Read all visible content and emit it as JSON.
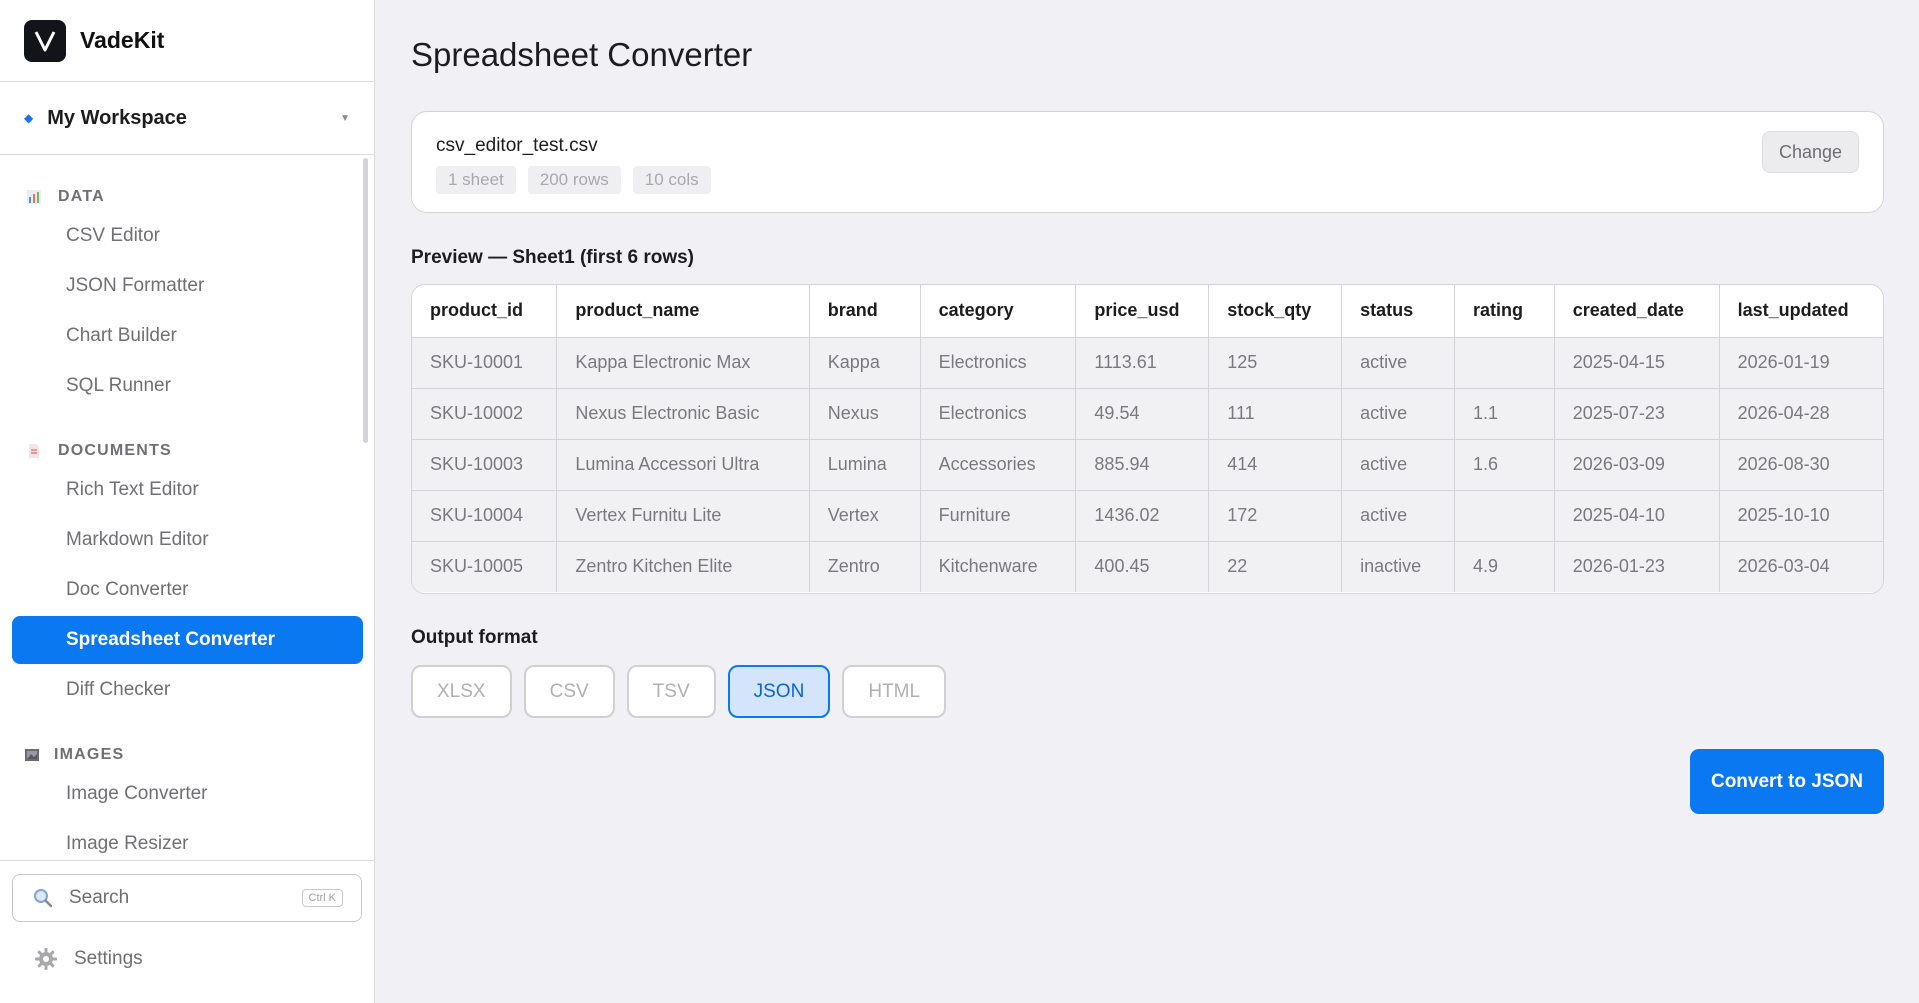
{
  "app": {
    "name": "VadeKit"
  },
  "workspace": {
    "name": "My Workspace"
  },
  "sidebar": {
    "sections": [
      {
        "title": "DATA",
        "icon": "bar-chart-icon",
        "items": [
          "CSV Editor",
          "JSON Formatter",
          "Chart Builder",
          "SQL Runner"
        ]
      },
      {
        "title": "DOCUMENTS",
        "icon": "document-icon",
        "items": [
          "Rich Text Editor",
          "Markdown Editor",
          "Doc Converter",
          "Spreadsheet Converter",
          "Diff Checker"
        ]
      },
      {
        "title": "IMAGES",
        "icon": "image-icon",
        "items": [
          "Image Converter",
          "Image Resizer"
        ]
      }
    ],
    "active_item": "Spreadsheet Converter",
    "search": {
      "label": "Search",
      "shortcut": "Ctrl K"
    },
    "settings_label": "Settings"
  },
  "main": {
    "title": "Spreadsheet Converter",
    "file": {
      "name": "csv_editor_test.csv",
      "chips": [
        "1 sheet",
        "200 rows",
        "10 cols"
      ],
      "change_label": "Change"
    },
    "preview": {
      "title": "Preview — Sheet1 (first 6 rows)",
      "columns": [
        "product_id",
        "product_name",
        "brand",
        "category",
        "price_usd",
        "stock_qty",
        "status",
        "rating",
        "created_date",
        "last_updated"
      ],
      "rows": [
        [
          "SKU-10001",
          "Kappa Electronic Max",
          "Kappa",
          "Electronics",
          "1113.61",
          "125",
          "active",
          "",
          "2025-04-15",
          "2026-01-19"
        ],
        [
          "SKU-10002",
          "Nexus Electronic Basic",
          "Nexus",
          "Electronics",
          "49.54",
          "111",
          "active",
          "1.1",
          "2025-07-23",
          "2026-04-28"
        ],
        [
          "SKU-10003",
          "Lumina Accessori Ultra",
          "Lumina",
          "Accessories",
          "885.94",
          "414",
          "active",
          "1.6",
          "2026-03-09",
          "2026-08-30"
        ],
        [
          "SKU-10004",
          "Vertex Furnitu Lite",
          "Vertex",
          "Furniture",
          "1436.02",
          "172",
          "active",
          "",
          "2025-04-10",
          "2025-10-10"
        ],
        [
          "SKU-10005",
          "Zentro Kitchen Elite",
          "Zentro",
          "Kitchenware",
          "400.45",
          "22",
          "inactive",
          "4.9",
          "2026-01-23",
          "2026-03-04"
        ]
      ]
    },
    "output": {
      "title": "Output format",
      "formats": [
        "XLSX",
        "CSV",
        "TSV",
        "JSON",
        "HTML"
      ],
      "selected": "JSON"
    },
    "convert_label": "Convert to JSON"
  },
  "colors": {
    "accent": "#0a78f0",
    "accent_light": "#d4e5fb",
    "background": "#f0f0f5"
  }
}
